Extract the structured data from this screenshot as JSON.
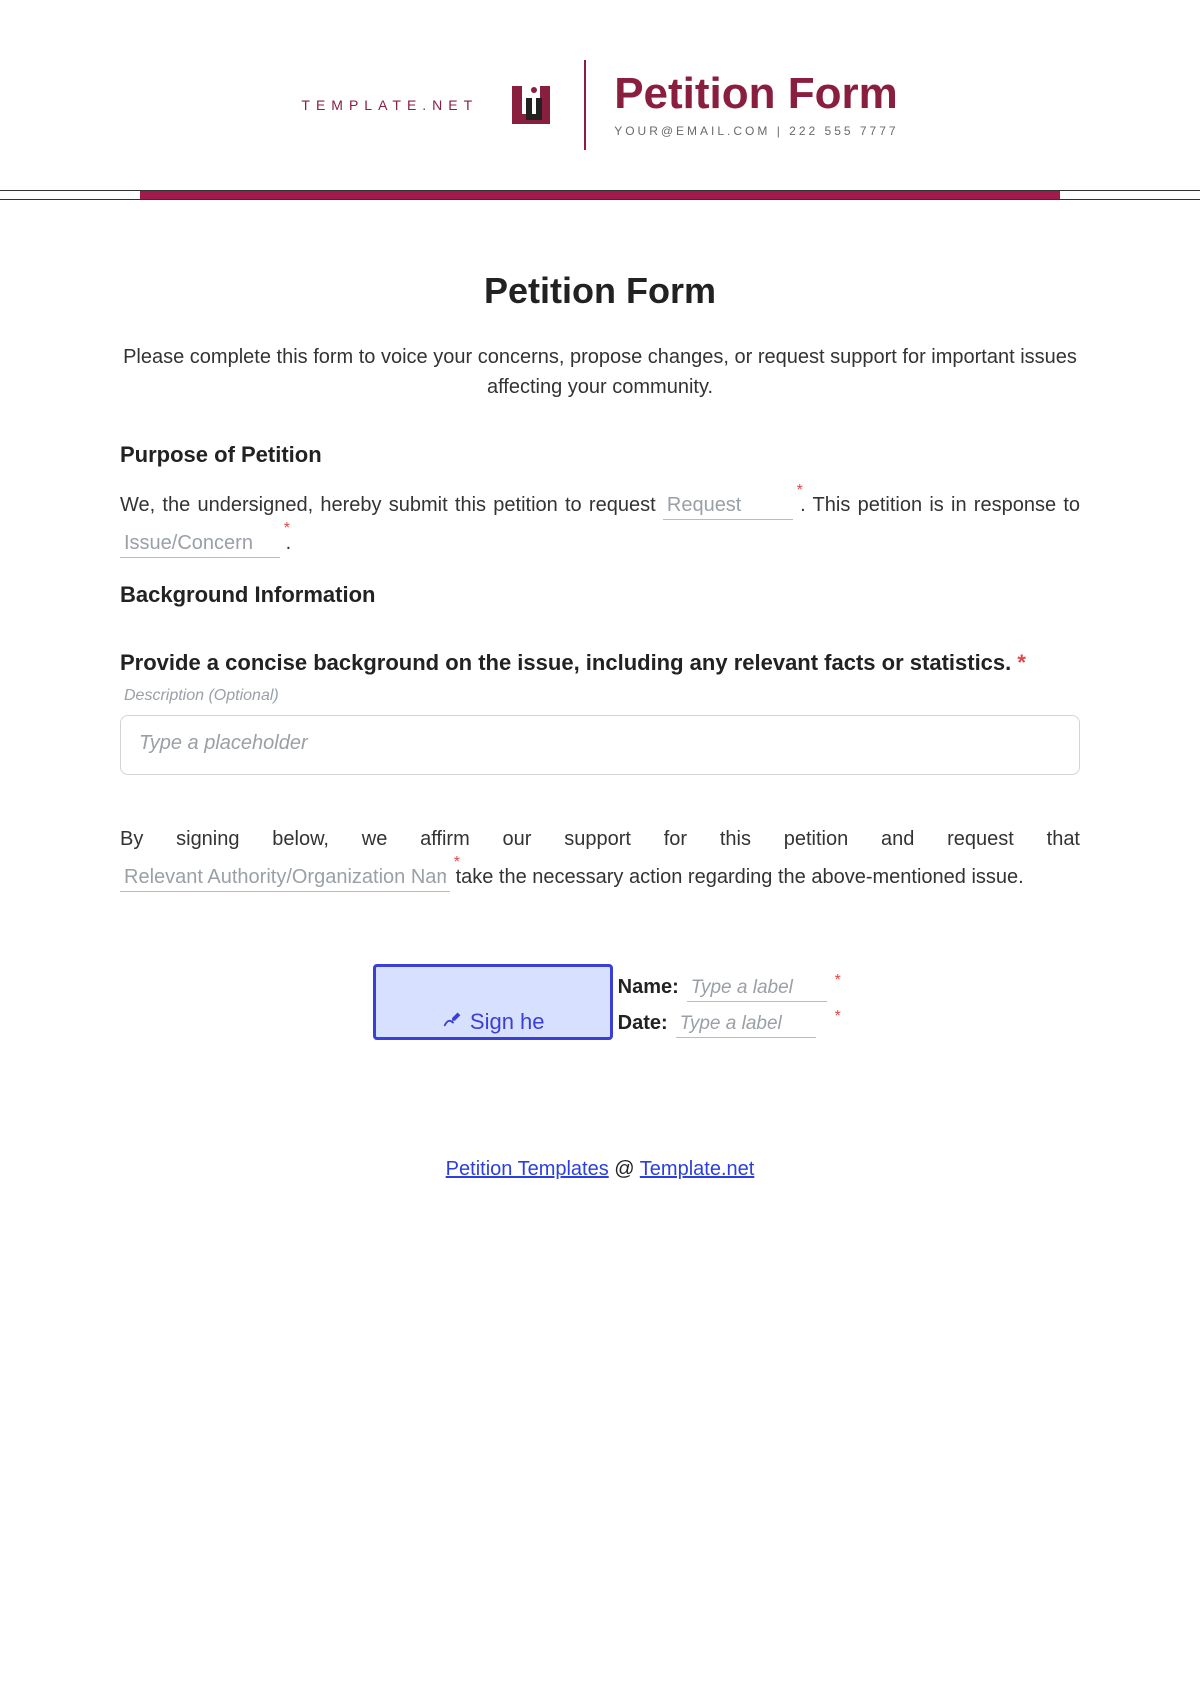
{
  "header": {
    "brand": "TEMPLATE.NET",
    "title": "Petition Form",
    "contact": "YOUR@EMAIL.COM | 222 555 7777"
  },
  "form": {
    "title": "Petition Form",
    "intro": "Please complete this form to voice your concerns, propose changes, or request support for important issues affecting your community.",
    "purpose_heading": "Purpose of Petition",
    "purpose_text_1": "We, the undersigned, hereby submit this petition to request ",
    "purpose_text_2": ". This petition is in response to ",
    "purpose_text_3": ".",
    "request_placeholder": "Request",
    "issue_placeholder": "Issue/Concern",
    "background_heading": "Background Information",
    "background_question": "Provide a concise background on the issue, including any relevant facts or statistics.",
    "description_hint": "Description (Optional)",
    "textarea_placeholder": "Type a placeholder",
    "affirm_text_1": "By signing below, we affirm our support for this petition and request that ",
    "affirm_text_2": " take the necessary action regarding the above-mentioned issue.",
    "authority_placeholder": "Relevant Authority/Organization Name",
    "sign_label": "Sign he",
    "name_label": "Name:",
    "date_label": "Date:",
    "label_placeholder": "Type a label"
  },
  "footer": {
    "link1": "Petition Templates",
    "at": " @ ",
    "link2": "Template.net"
  },
  "required_marker": "*"
}
